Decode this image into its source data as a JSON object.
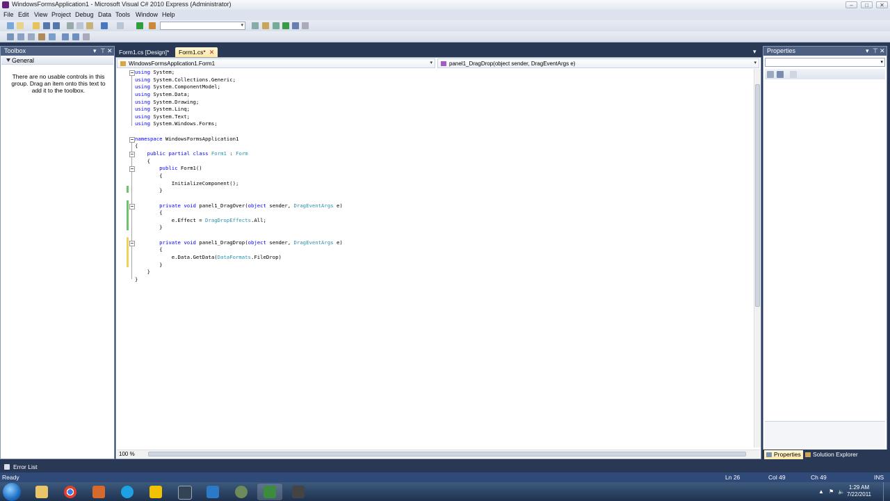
{
  "window": {
    "title": "WindowsFormsApplication1 - Microsoft Visual C# 2010 Express (Administrator)",
    "minimize": "–",
    "maximize": "□",
    "close": "✕"
  },
  "menu": [
    "File",
    "Edit",
    "View",
    "Project",
    "Debug",
    "Data",
    "Tools",
    "Window",
    "Help"
  ],
  "toolbar": {
    "config_combo_value": "",
    "dropdown_arrow": "▾"
  },
  "toolbox": {
    "title": "Toolbox",
    "pin": "⊤",
    "close": "✕",
    "menu": "▾",
    "group_label": "General",
    "empty_message": "There are no usable controls in this group. Drag an item onto this text to add it to the toolbox."
  },
  "tabs": [
    {
      "label": "Form1.cs [Design]*",
      "active": false
    },
    {
      "label": "Form1.cs*",
      "active": true
    }
  ],
  "tab_close": "✕",
  "tab_overflow": "▾",
  "editor": {
    "nav_class": "WindowsFormsApplication1.Form1",
    "nav_member": "panel1_DragDrop(object sender, DragEventArgs e)",
    "zoom": "100 %",
    "code_lines": [
      [
        {
          "t": "using",
          "c": "kw"
        },
        {
          "t": " System;"
        }
      ],
      [
        {
          "t": "using",
          "c": "kw"
        },
        {
          "t": " System.Collections.Generic;"
        }
      ],
      [
        {
          "t": "using",
          "c": "kw"
        },
        {
          "t": " System.ComponentModel;"
        }
      ],
      [
        {
          "t": "using",
          "c": "kw"
        },
        {
          "t": " System.Data;"
        }
      ],
      [
        {
          "t": "using",
          "c": "kw"
        },
        {
          "t": " System.Drawing;"
        }
      ],
      [
        {
          "t": "using",
          "c": "kw"
        },
        {
          "t": " System.Linq;"
        }
      ],
      [
        {
          "t": "using",
          "c": "kw"
        },
        {
          "t": " System.Text;"
        }
      ],
      [
        {
          "t": "using",
          "c": "kw"
        },
        {
          "t": " System.Windows.Forms;"
        }
      ],
      [],
      [
        {
          "t": "namespace",
          "c": "kw"
        },
        {
          "t": " WindowsFormsApplication1"
        }
      ],
      [
        {
          "t": "{"
        }
      ],
      [
        {
          "t": "    "
        },
        {
          "t": "public",
          "c": "kw"
        },
        {
          "t": " "
        },
        {
          "t": "partial",
          "c": "kw"
        },
        {
          "t": " "
        },
        {
          "t": "class",
          "c": "kw"
        },
        {
          "t": " "
        },
        {
          "t": "Form1",
          "c": "ty"
        },
        {
          "t": " : "
        },
        {
          "t": "Form",
          "c": "ty"
        }
      ],
      [
        {
          "t": "    {"
        }
      ],
      [
        {
          "t": "        "
        },
        {
          "t": "public",
          "c": "kw"
        },
        {
          "t": " Form1()"
        }
      ],
      [
        {
          "t": "        {"
        }
      ],
      [
        {
          "t": "            InitializeComponent();"
        }
      ],
      [
        {
          "t": "        }"
        }
      ],
      [],
      [
        {
          "t": "        "
        },
        {
          "t": "private",
          "c": "kw"
        },
        {
          "t": " "
        },
        {
          "t": "void",
          "c": "kw"
        },
        {
          "t": " panel1_DragOver("
        },
        {
          "t": "object",
          "c": "kw"
        },
        {
          "t": " sender, "
        },
        {
          "t": "DragEventArgs",
          "c": "ty"
        },
        {
          "t": " e)"
        }
      ],
      [
        {
          "t": "        {"
        }
      ],
      [
        {
          "t": "            e.Effect = "
        },
        {
          "t": "DragDropEffects",
          "c": "ty"
        },
        {
          "t": ".All;"
        }
      ],
      [
        {
          "t": "        }"
        }
      ],
      [],
      [
        {
          "t": "        "
        },
        {
          "t": "private",
          "c": "kw"
        },
        {
          "t": " "
        },
        {
          "t": "void",
          "c": "kw"
        },
        {
          "t": " panel1_DragDrop("
        },
        {
          "t": "object",
          "c": "kw"
        },
        {
          "t": " sender, "
        },
        {
          "t": "DragEventArgs",
          "c": "ty"
        },
        {
          "t": " e)"
        }
      ],
      [
        {
          "t": "        {"
        }
      ],
      [
        {
          "t": "            e.Data.GetData("
        },
        {
          "t": "DataFormats",
          "c": "ty"
        },
        {
          "t": ".FileDrop)"
        }
      ],
      [
        {
          "t": "        }"
        }
      ],
      [
        {
          "t": "    }"
        }
      ],
      [
        {
          "t": "}"
        }
      ]
    ]
  },
  "properties": {
    "title": "Properties",
    "pin": "⊤",
    "close": "✕",
    "menu": "▾",
    "combo_arrow": "▾"
  },
  "right_tabs": {
    "properties": "Properties",
    "solution_explorer": "Solution Explorer"
  },
  "error_list": "Error List",
  "status": {
    "ready": "Ready",
    "line": "Ln 26",
    "col": "Col 49",
    "ch": "Ch 49",
    "mode": "INS"
  },
  "taskbar": {
    "time": "1:29 AM",
    "date": "7/22/2011",
    "tray_up": "▲",
    "tray_flag": "⚑",
    "tray_volume": "🔈"
  },
  "colors": {
    "keyword": "#0000ff",
    "type": "#2b91af",
    "changed_saved": "#6cc46c",
    "changed_unsaved": "#f0d25a",
    "chrome": "#293955"
  }
}
